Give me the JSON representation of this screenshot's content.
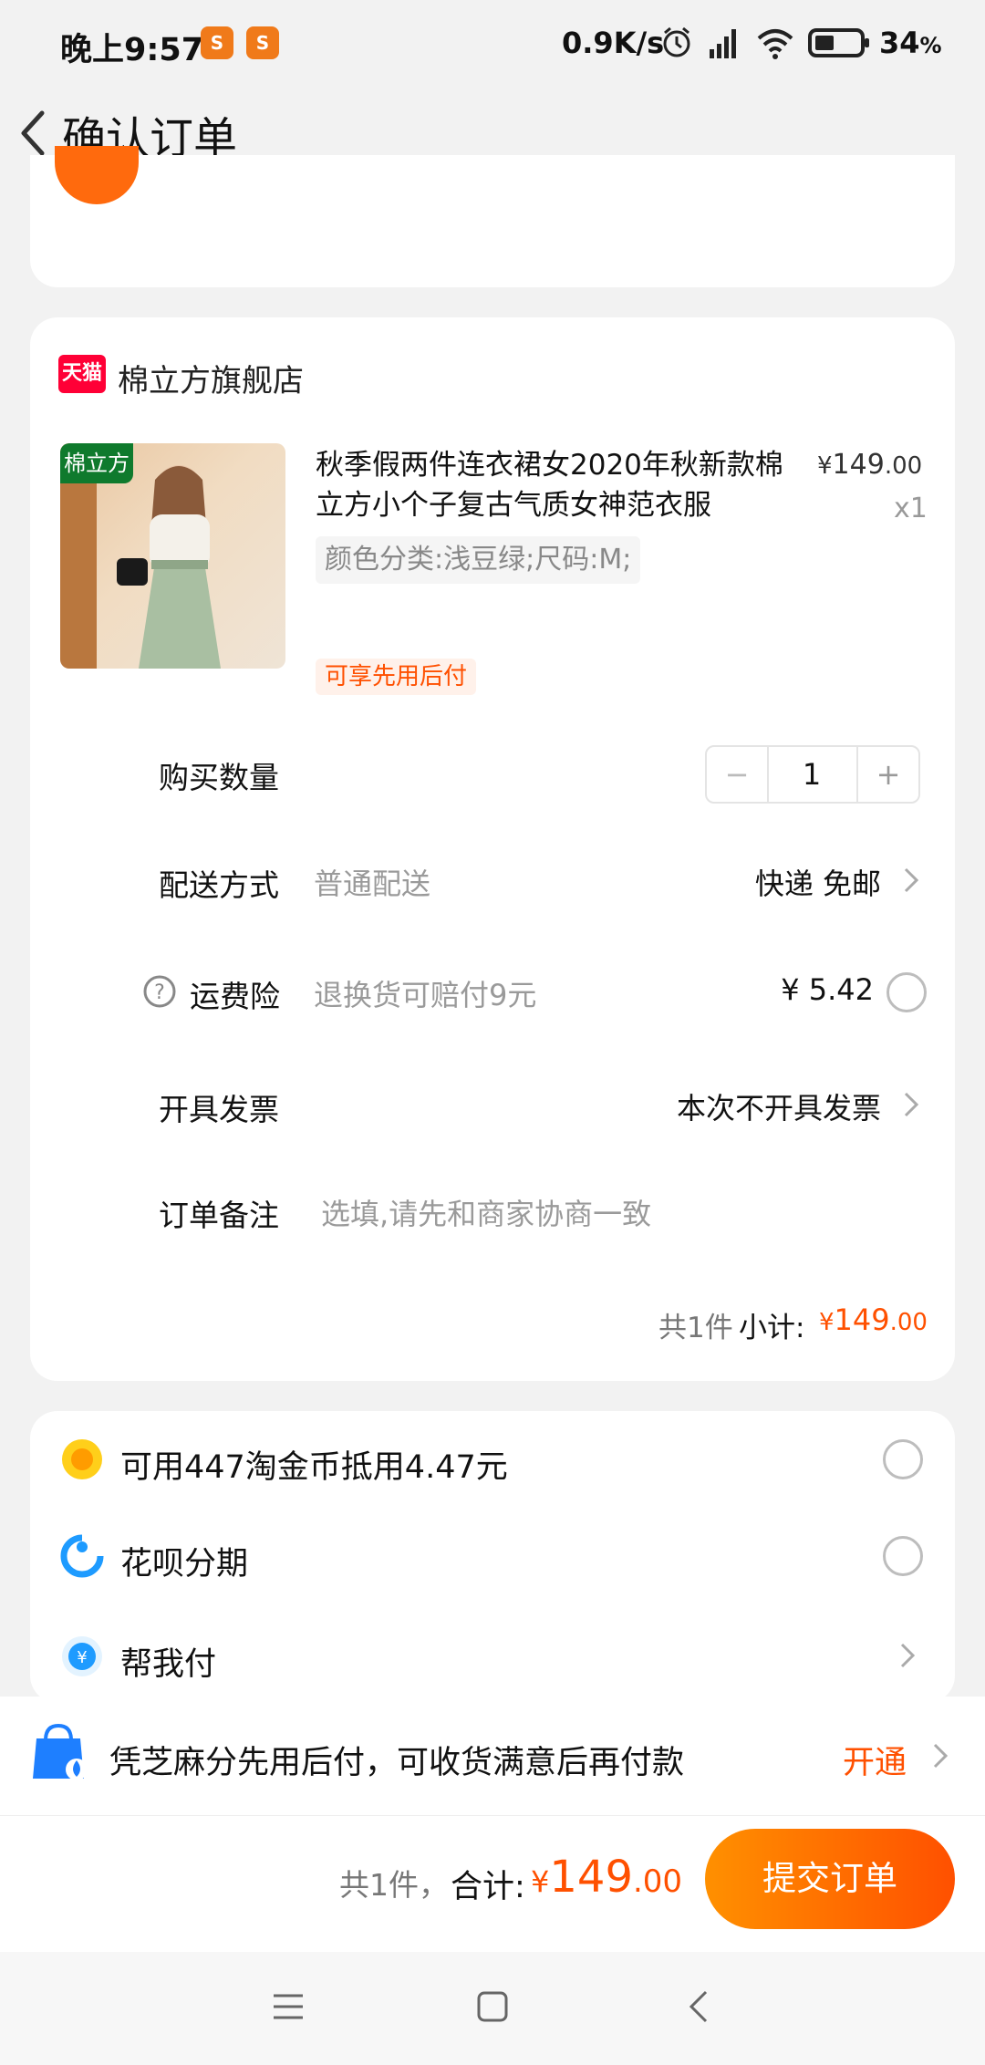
{
  "status_bar": {
    "time": "晚上9:57",
    "app_badge": "S",
    "network_speed": "0.9K/s",
    "battery": "34",
    "battery_unit": "%"
  },
  "header": {
    "title": "确认订单"
  },
  "order": {
    "shop_badge": "天猫",
    "shop_name": "棉立方旗舰店",
    "image_badge": "棉立方",
    "title": "秋季假两件连衣裙女2020年秋新款棉立方小个子复古气质女神范衣服",
    "currency": "¥",
    "price_int": "149",
    "price_dec": ".00",
    "quantity_label": "x1",
    "sku": "颜色分类:浅豆绿;尺码:M;",
    "pay_later_tag": "可享先用后付",
    "rows": {
      "buy_qty": "购买数量",
      "qty_value": "1",
      "minus": "−",
      "plus": "+",
      "delivery_label": "配送方式",
      "delivery_sub": "普通配送",
      "delivery_value": "快递 免邮",
      "insurance_label": "运费险",
      "insurance_sub": "退换货可赔付9元",
      "insurance_value": "¥ 5.42",
      "invoice_label": "开具发票",
      "invoice_value": "本次不开具发票",
      "note_label": "订单备注",
      "note_placeholder": "选填,请先和商家协商一致"
    },
    "subtotal": {
      "count": "共1件",
      "label": "小计:",
      "currency": "¥",
      "amount_int": "149",
      "amount_dec": ".00"
    }
  },
  "payment_options": [
    {
      "label": "可用447淘金币抵用4.47元",
      "icon": "coin-icon"
    },
    {
      "label": "花呗分期",
      "icon": "huabei-icon"
    },
    {
      "label": "帮我付",
      "icon": "help-pay-icon"
    }
  ],
  "banner": {
    "text": "凭芝麻分先用后付，可收货满意后再付款",
    "action": "开通"
  },
  "bottom": {
    "count": "共1件，",
    "total_label": "合计:",
    "currency": "¥",
    "total_int": "149",
    "total_dec": ".00",
    "submit": "提交订单"
  },
  "colors": {
    "accent": "#ff5000",
    "tmall_red": "#ff0036"
  }
}
